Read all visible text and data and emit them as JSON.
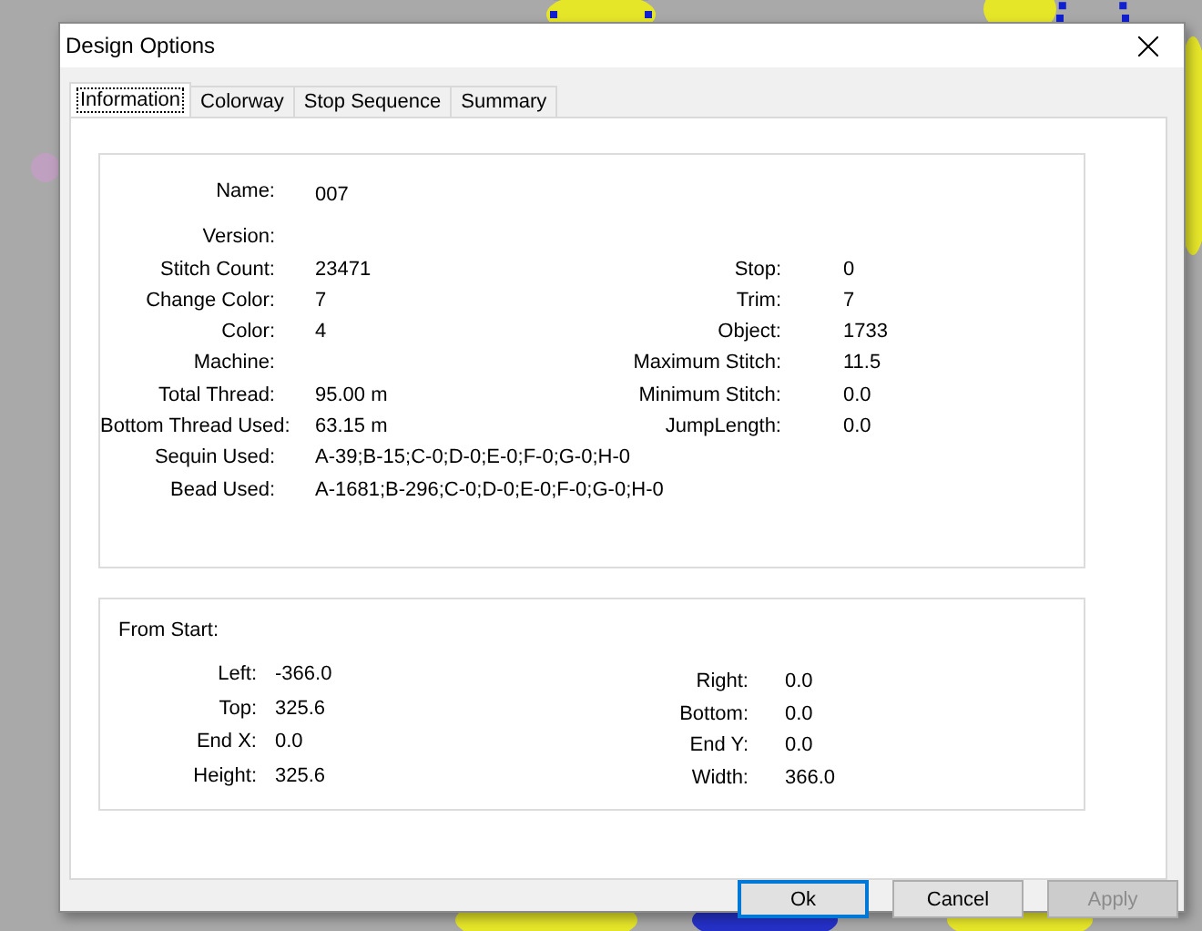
{
  "window": {
    "title": "Design Options"
  },
  "tabs": [
    {
      "label": "Information",
      "selected": true
    },
    {
      "label": "Colorway",
      "selected": false
    },
    {
      "label": "Stop Sequence",
      "selected": false
    },
    {
      "label": "Summary",
      "selected": false
    }
  ],
  "information": {
    "name": {
      "label": "Name:",
      "value": "007"
    },
    "rows": [
      {
        "left": {
          "label": "Version:"
        }
      },
      {
        "left": {
          "label": "Stitch Count:",
          "value": "23471"
        },
        "right": {
          "label": "Stop:",
          "value": "0"
        }
      },
      {
        "left": {
          "label": "Change Color:",
          "value": "7"
        },
        "right": {
          "label": "Trim:",
          "value": "7"
        }
      },
      {
        "left": {
          "label": "Color:",
          "value": "4"
        },
        "right": {
          "label": "Object:",
          "value": "1733"
        }
      },
      {
        "left": {
          "label": "Machine:"
        },
        "right": {
          "label": "Maximum Stitch:",
          "value": "11.5"
        }
      },
      {
        "left": {
          "label": "Total Thread:",
          "value": "95.00 m"
        },
        "right": {
          "label": "Minimum Stitch:",
          "value": "0.0"
        }
      },
      {
        "left": {
          "label": "Bottom Thread Used:",
          "value": "63.15 m"
        },
        "right": {
          "label": "JumpLength:",
          "value": "0.0"
        }
      },
      {
        "left": {
          "label": "Sequin Used:",
          "value": "A-39;B-15;C-0;D-0;E-0;F-0;G-0;H-0"
        }
      },
      {
        "left": {
          "label": "Bead Used:",
          "value": "A-1681;B-296;C-0;D-0;E-0;F-0;G-0;H-0"
        }
      }
    ]
  },
  "from_start": {
    "title": "From Start:",
    "left": [
      {
        "label": "Left:",
        "value": "-366.0"
      },
      {
        "label": "Top:",
        "value": "325.6"
      },
      {
        "label": "End X:",
        "value": "0.0"
      },
      {
        "label": "Height:",
        "value": "325.6"
      }
    ],
    "right": [
      {
        "label": "Right:",
        "value": "0.0"
      },
      {
        "label": "Bottom:",
        "value": "0.0"
      },
      {
        "label": "End Y:",
        "value": "0.0"
      },
      {
        "label": "Width:",
        "value": "366.0"
      }
    ]
  },
  "buttons": [
    {
      "label": "Ok",
      "default": true,
      "disabled": false
    },
    {
      "label": "Cancel",
      "default": false,
      "disabled": false
    },
    {
      "label": "Apply",
      "default": false,
      "disabled": true
    }
  ]
}
